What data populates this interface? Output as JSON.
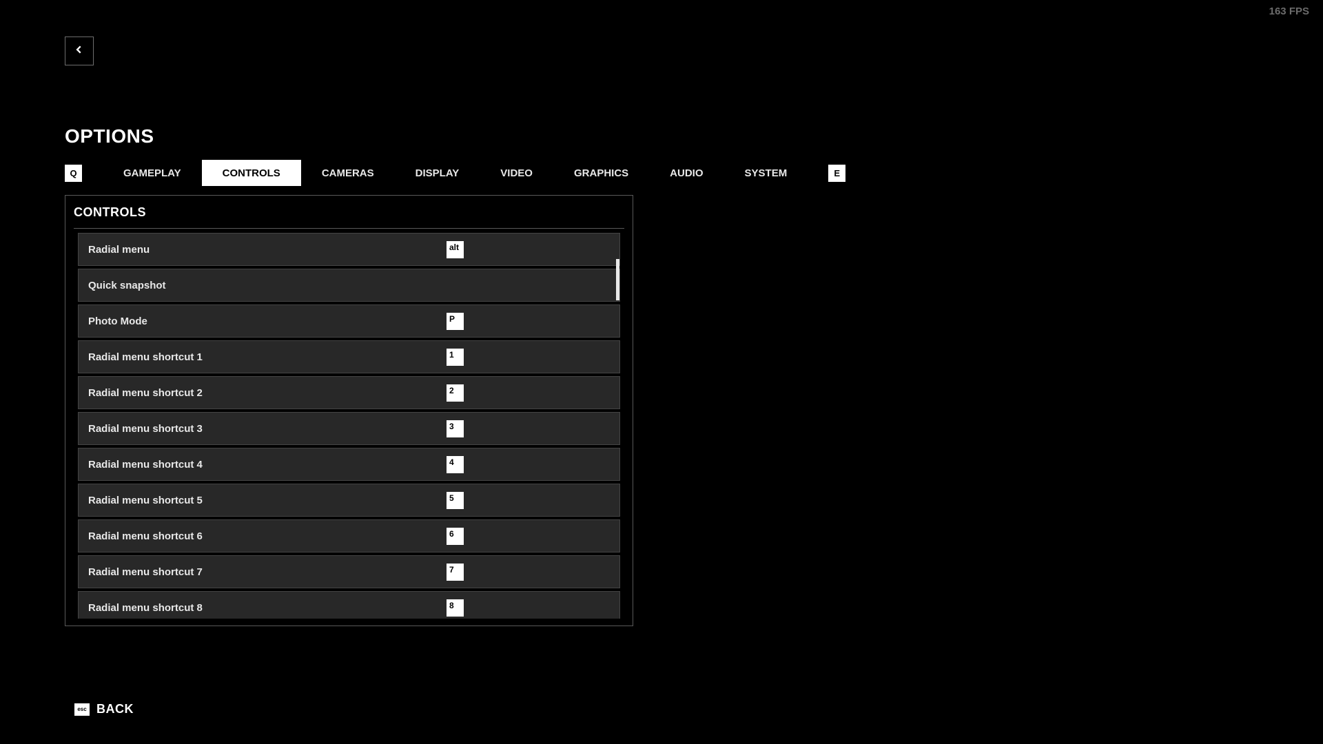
{
  "fps": "163 FPS",
  "header": {
    "title": "OPTIONS"
  },
  "tabs": {
    "prev_key": "Q",
    "next_key": "E",
    "items": [
      {
        "label": "GAMEPLAY",
        "active": false
      },
      {
        "label": "CONTROLS",
        "active": true
      },
      {
        "label": "CAMERAS",
        "active": false
      },
      {
        "label": "DISPLAY",
        "active": false
      },
      {
        "label": "VIDEO",
        "active": false
      },
      {
        "label": "GRAPHICS",
        "active": false
      },
      {
        "label": "AUDIO",
        "active": false
      },
      {
        "label": "SYSTEM",
        "active": false
      }
    ]
  },
  "panel": {
    "title": "CONTROLS",
    "rows": [
      {
        "label": "Radial menu",
        "key": "alt"
      },
      {
        "label": "Quick snapshot",
        "key": ""
      },
      {
        "label": "Photo Mode",
        "key": "P"
      },
      {
        "label": "Radial menu shortcut 1",
        "key": "1"
      },
      {
        "label": "Radial menu shortcut 2",
        "key": "2"
      },
      {
        "label": "Radial menu shortcut 3",
        "key": "3"
      },
      {
        "label": "Radial menu shortcut 4",
        "key": "4"
      },
      {
        "label": "Radial menu shortcut 5",
        "key": "5"
      },
      {
        "label": "Radial menu shortcut 6",
        "key": "6"
      },
      {
        "label": "Radial menu shortcut 7",
        "key": "7"
      },
      {
        "label": "Radial menu shortcut 8",
        "key": "8"
      }
    ]
  },
  "footer": {
    "back_key": "esc",
    "back_label": "BACK"
  }
}
